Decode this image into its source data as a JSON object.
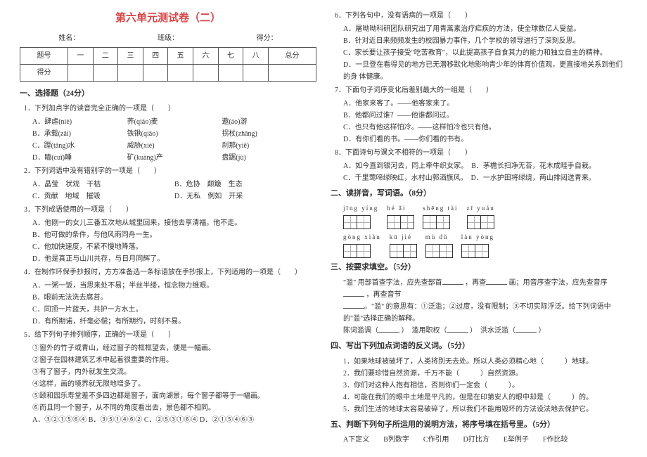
{
  "title": "第六单元测试卷（二）",
  "meta": {
    "name": "姓名：",
    "class": "班级：",
    "score": "得分："
  },
  "score_headers": [
    "题号",
    "一",
    "二",
    "三",
    "四",
    "五",
    "六",
    "七",
    "八",
    "总分"
  ],
  "score_row": "得分",
  "s1": {
    "h": "一、选择题（24分）",
    "q1": {
      "stem": "1．下列加点字的读音完全正确的一项是（　　）",
      "a": [
        "A．肆虐(niè)",
        "荞(qiáo)麦",
        "遨(áo)游"
      ],
      "b": [
        "B．承载(zǎi)",
        "铁锹(qiāo)",
        "拐杖(zhǎng)"
      ],
      "c": [
        "C．蹚(tāng)水",
        "威胁(xiè)",
        "刹那(yiē)"
      ],
      "d": [
        "D．瞌(cuī)睡",
        "矿(kuàng)产",
        "盘踞(jù)"
      ]
    },
    "q2": {
      "stem": "2．下列词语中没有错别字的一项是（　　）",
      "a1": "A．晶莹　状观　干枯",
      "a2": "B．危协　颠簸　生态",
      "b1": "C．贡献　地域　摧毁",
      "b2": "D．无私　例如　开采"
    },
    "q3": {
      "stem": "3．下列成语使用的一项是（　　）",
      "a": "A．他刚一的女儿三番五次地从城里回来，接他去享清福，他不走。",
      "b": "B．他可做的条件，与他风雨同舟一生。",
      "c": "C．他加快速度，不紧不慢地降落。",
      "d": "D．他是真正与山川共存，与日月同辉了。"
    },
    "q4": {
      "stem": "4．在制作环保手抄报时，方方准备选一条标语放在手抄报上，下列适用的一项是（　　）",
      "a": "A．一粥一饭，当思来处不易；半丝半缕，恒念物力维艰。",
      "b": "B．眼前无法洗去腐苔。",
      "c": "C．同顶一片蓝天，共护一方水土。",
      "d": "D．有所期诺，纤毫必偿；有所期约，时刻不易。"
    },
    "q5": {
      "stem": "5．给下列句子排列顺序，正确的一项是（　　）",
      "l": [
        "①窗外的竹子或青山，经过窗子的框框望去，便是一幅画。",
        "②窗子在园林建筑艺术中起着很重要的作用。",
        "③有了窗子，内外就发生交流。",
        "④这样，画的境界就无限地增多了。",
        "⑤颐和园乐寿堂差不多四边都是窗子，面向湖景，每个窗子都等于一幅画。",
        "⑥而且同一个窗子，从不同的角度看出去，景色都不相同。"
      ],
      "opts": "A．③②①⑤⑥④   B．③⑤①④⑥②   C．②⑤③①⑥④   D．②①⑤④⑥③"
    }
  },
  "col2": {
    "q6": {
      "stem": "6．下列各句中，没有语病的一项是（　　）",
      "a": "A．屠呦呦科研团队研究出了用青蒿素治疗疟疾的方法，使全球数亿人受益。",
      "b": "B．针对近日来频频发生的校园暴力事件，几个学校的领导进行了深刻反思。",
      "c": "C．家长要让孩子接受\"吃苦教育\"，以此提高孩子自食其力的能力和独立自主的精神。",
      "d": "D．一旦登在看得见的地方已无潜移默化地影响青少年的体育价值观，更直接地关系到他们的身 体健康。"
    },
    "q7": {
      "stem": "7．下面句子词序变化后差别最大的一组是（　　）",
      "a": "A．他家来客了。——他客家来了。",
      "b": "B．他都问过谁？——他谁都问过。",
      "c": "C．也只有他这样怕冷。——这样怕冷也只有他。",
      "d": "D．有你们看的书。——你们看的书有。"
    },
    "q8": {
      "stem": "8．下面诗句与课文不相符的一项是（　　）",
      "a": "A．如今直到银河去，同上牵牛织女家。　B．茅檐长扫净无苔，花木成畦手自栽。",
      "c": "C．千里莺啼绿映红，水村山郭酒旗风。　D．一水护田将绿绕，两山排闼送青来。"
    },
    "s2": {
      "h": "二、读拼音，写词语。（8分）",
      "r1": [
        {
          "py": "jīng yíng",
          "n": 2
        },
        {
          "py": "hé ǎi",
          "n": 2
        },
        {
          "py": "shēng tài",
          "n": 2
        },
        {
          "py": "zī yuán",
          "n": 2
        }
      ],
      "r2": [
        {
          "py": "gòng xiàn",
          "n": 2
        },
        {
          "py": "kū jié",
          "n": 2
        },
        {
          "py": "mù dǔ",
          "n": 2
        },
        {
          "py": "làn yòng",
          "n": 2
        }
      ]
    },
    "s3": {
      "h": "三、按要求填空。（5分）",
      "l1a": "\"滥\" 用部首查字法，应先查部首",
      "l1b": "，再查",
      "l1c": "画；用音序查字法，应先查音序",
      "l1d": "，再查音节",
      "l2a": "。\"滥\" 的意思有：①泛滥；②过度，没有限制；③不切实际浮泛。给下列词语中 的\"滥\"选择正确的解释。",
      "l3a": "陈词滥调（",
      "l3b": "）　滥用职权（",
      "l3c": "）　洪水泛滥（",
      "l3d": "）"
    },
    "s4": {
      "h": "四、写出下列加点词语的反义词。（5分）",
      "l": [
        "1．如果地球被破坏了，人类将别无去处。所以人类必须精心地（　　　）地球。",
        "2．我们要珍惜自然资源，千万不能（　　　）自然资源。",
        "3．你们对这种人抱有相信，否则你们一定会（　　　）。",
        "4．可能在我们的眼中土地是平凡的，但是在印第安人的眼中却是（　　　）的。",
        "5．我们生活的地球太容易破碎了，所以我们不能用毁坏的方法设法地去保护它。"
      ]
    },
    "s5": {
      "h": "五、判断下列句子所运用的说明方法，将序号填在括号里。（5分）",
      "opts": "A下定义　　B列数字　　C作引用　　D打比方　　E举例子　　F作比较"
    }
  }
}
